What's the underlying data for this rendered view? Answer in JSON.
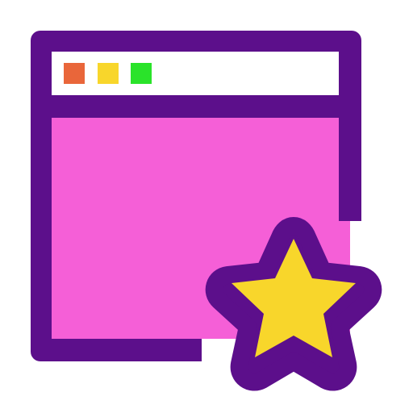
{
  "icon": {
    "name": "favorite-window-icon",
    "components": [
      "browser-window-icon",
      "star-icon"
    ]
  },
  "colors": {
    "outline": "#5c0f8b",
    "content": "#f55fd7",
    "titlebar": "#ffffff",
    "dot_red": "#e9663a",
    "dot_yellow": "#f8d62b",
    "dot_green": "#2ae32a",
    "star_fill": "#f8d62b"
  }
}
